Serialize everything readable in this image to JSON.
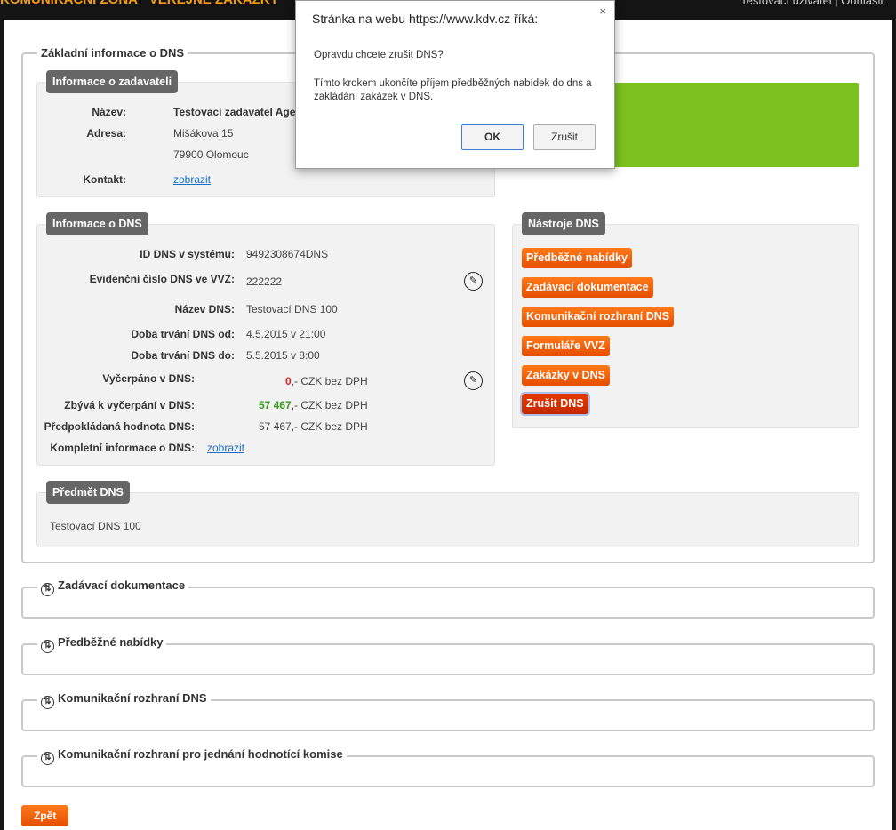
{
  "top": {
    "brand": "KOMUNIKAČNÍ ZÓNA · VEŘEJNÉ ZAKÁZKY",
    "user": "Testovací uživatel | Odhlásit"
  },
  "main": {
    "legend": "Základní informace o DNS",
    "zadavatel": {
      "title": "Informace o zadavateli",
      "nazev_label": "Název:",
      "nazev": "Testovací zadavatel Agentura",
      "adresa_label": "Adresa:",
      "adresa1": "Mišákova 15",
      "adresa2": "79900 Olomouc",
      "kontakt_label": "Kontakt:",
      "kontakt_link": "zobrazit"
    },
    "dns": {
      "title": "Informace o DNS",
      "rows": [
        {
          "label": "ID DNS v systému:",
          "value": "9492308674DNS"
        },
        {
          "label": "Evidenční číslo DNS ve VVZ:",
          "value": "222222"
        },
        {
          "label": "Název DNS:",
          "value": "Testovací DNS 100"
        },
        {
          "label": "Doba trvání DNS od:",
          "value": "4.5.2015 v 21:00"
        },
        {
          "label": "Doba trvání DNS do:",
          "value": "5.5.2015 v 8:00"
        }
      ],
      "vycerpano_label": "Vyčerpáno v DNS:",
      "vycerpano_num": "0",
      "vycerpano_suffix": ",- CZK bez DPH",
      "zbyva_label": "Zbývá k vyčerpání v DNS:",
      "zbyva_num": "57 467",
      "zbyva_suffix": ",- CZK bez DPH",
      "predpoklad_label": "Předpokládaná hodnota DNS:",
      "predpoklad": "57 467,- CZK bez DPH",
      "kompletni_label": "Kompletní informace o DNS:",
      "kompletni_link": "zobrazit"
    },
    "nastroje": {
      "title": "Nástroje DNS",
      "buttons": [
        "Předběžné nabídky",
        "Zadávací dokumentace",
        "Komunikační rozhraní DNS",
        "Formuláře VVZ",
        "Zakázky v DNS",
        "Zrušit DNS"
      ]
    },
    "predmet": {
      "title": "Předmět DNS",
      "text": "Testovací DNS 100"
    }
  },
  "sections": [
    "Zadávací dokumentace",
    "Předběžné nabídky",
    "Komunikační rozhraní DNS",
    "Komunikační rozhraní pro jednání hodnotící komise"
  ],
  "back_label": "Zpět",
  "dialog": {
    "title": "Stránka na webu https://www.kdv.cz říká:",
    "close": "×",
    "question": "Opravdu chcete zrušit DNS?",
    "message": "Tímto krokem ukončíte příjem předběžných nabídek do dns a zakládání zakázek v DNS.",
    "ok": "OK",
    "cancel": "Zrušit"
  },
  "colors": {
    "orange": "#ff6a00",
    "green": "#7cc11f",
    "panel_title": "#666666"
  },
  "icons": {
    "section_toggle": "circle-arrows-icon",
    "edit": "pencil-icon"
  }
}
